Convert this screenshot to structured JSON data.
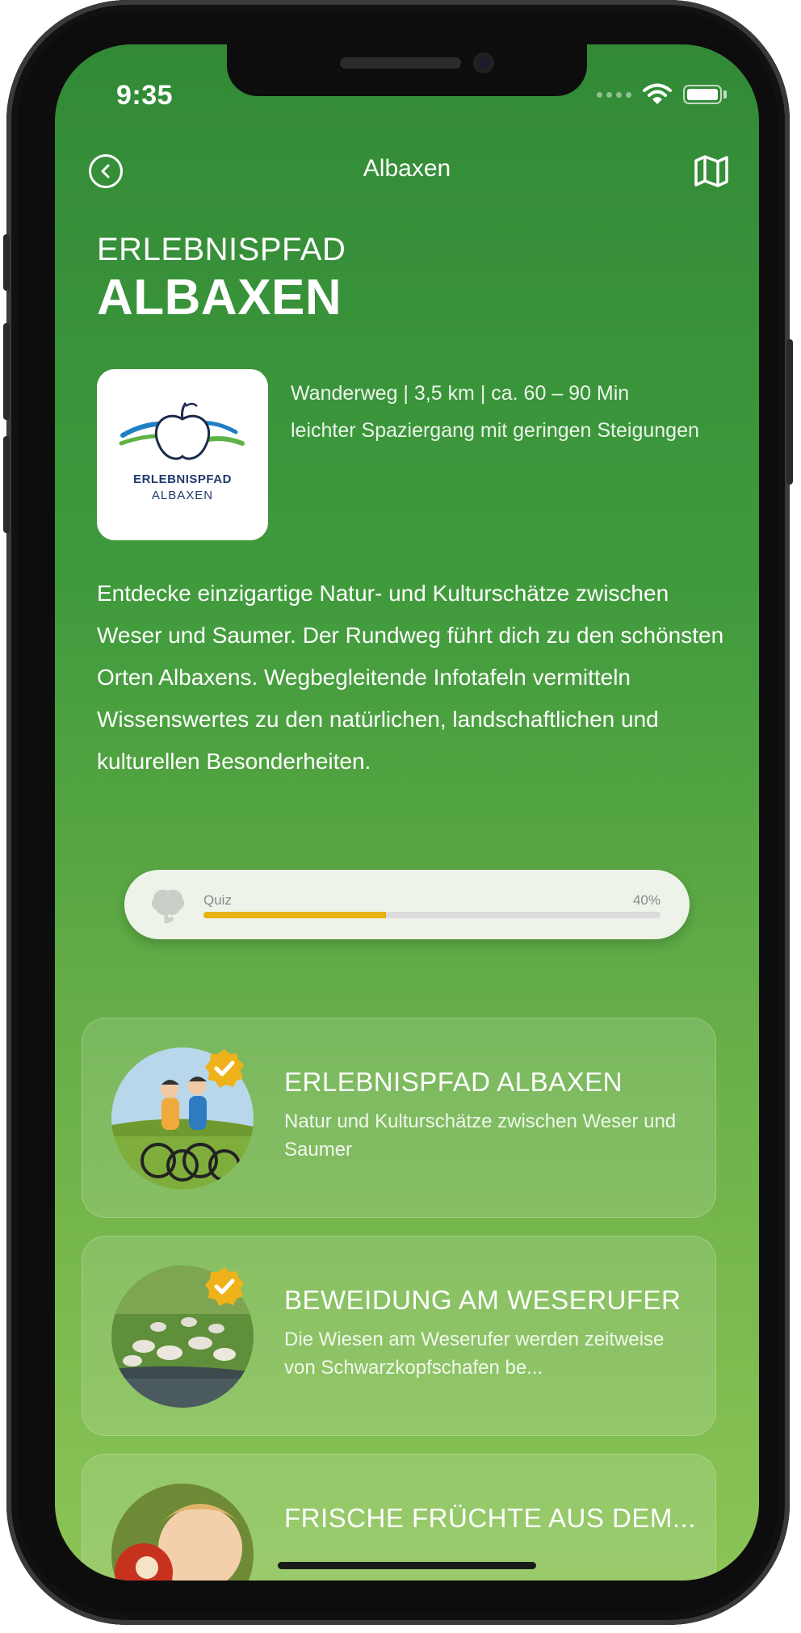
{
  "status_bar": {
    "time": "9:35"
  },
  "nav": {
    "title": "Albaxen"
  },
  "header": {
    "eyebrow": "ERLEBNISPFAD",
    "title": "ALBAXEN"
  },
  "logo": {
    "line1": "ERLEBNISPFAD",
    "line2": "ALBAXEN"
  },
  "meta": {
    "details": "Wanderweg | 3,5 km | ca. 60 – 90 Min",
    "difficulty": "leichter Spaziergang mit geringen Steigungen"
  },
  "description": "Entdecke einzigartige Natur- und Kulturschätze zwischen Weser und Saumer. Der Rundweg führt dich zu den schönsten Orten Albaxens. Wegbegleitende Infotafeln vermitteln Wissenswertes zu den natürlichen, landschaftlichen und kulturellen Besonderheiten.",
  "quiz": {
    "label": "Quiz",
    "percent_label": "40%",
    "progress": 0.4
  },
  "colors": {
    "accent_yellow": "#e7b10f",
    "background_top": "#328a37",
    "background_bottom": "#8cc456"
  },
  "stations": [
    {
      "title": "ERLEBNISPFAD ALBAXEN",
      "subtitle": "Natur und Kulturschätze zwischen Weser und Saumer",
      "completed": true,
      "image": "cyclists-photo"
    },
    {
      "title": "BEWEIDUNG AM WESERUFER",
      "subtitle": "Die Wiesen am Weserufer werden zeitweise von Schwarzkopfschafen be...",
      "completed": true,
      "image": "sheep-photo"
    },
    {
      "title": "FRISCHE FRÜCHTE AUS DEM...",
      "subtitle": "",
      "completed": false,
      "image": "child-apple-photo"
    }
  ]
}
